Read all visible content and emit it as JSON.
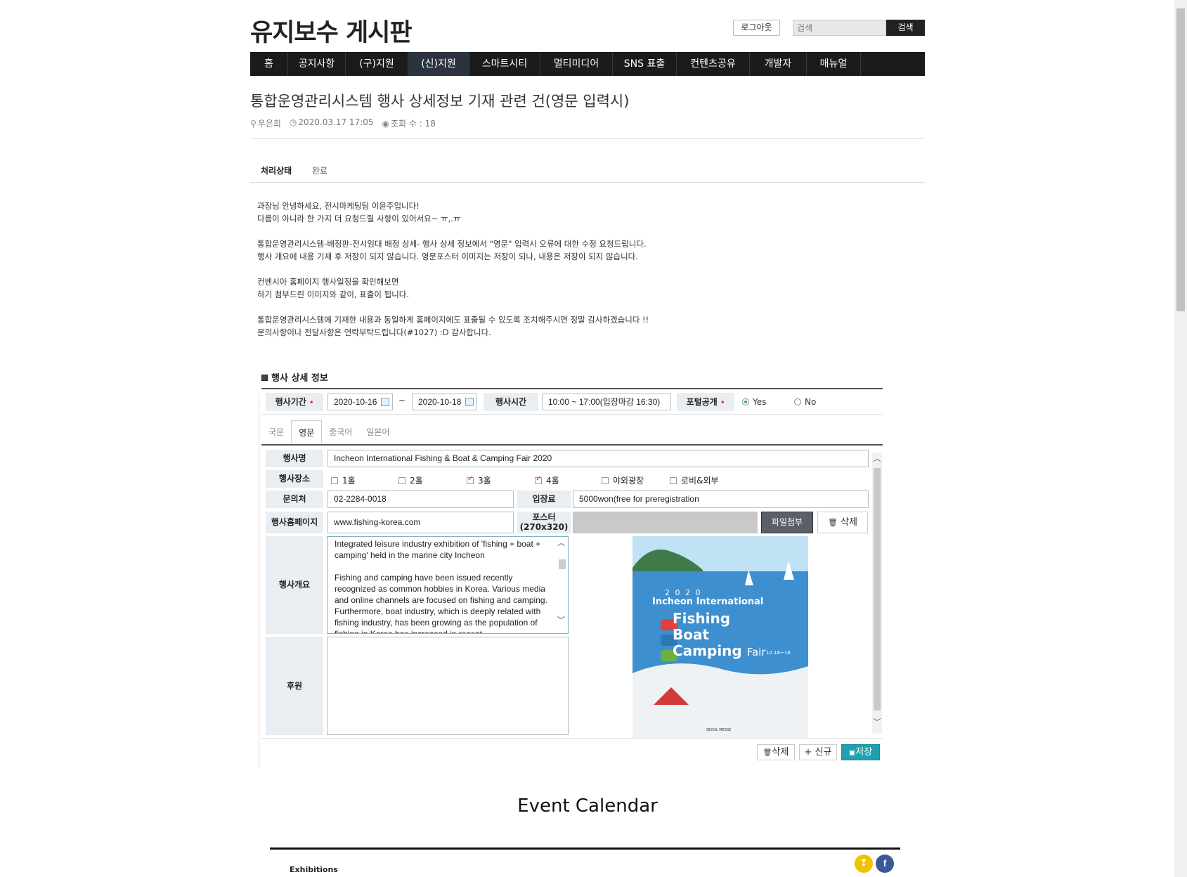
{
  "header": {
    "site_title": "유지보수 게시판",
    "logout_label": "로그아웃",
    "search_placeholder": "검색",
    "search_button": "검색"
  },
  "nav": [
    {
      "label": "홈"
    },
    {
      "label": "공지사항"
    },
    {
      "label": "(구)지원"
    },
    {
      "label": "(신)지원"
    },
    {
      "label": "스마트시티"
    },
    {
      "label": "멀티미디어"
    },
    {
      "label": "SNS 표출"
    },
    {
      "label": "컨텐츠공유"
    },
    {
      "label": "개발자"
    },
    {
      "label": "매뉴얼"
    }
  ],
  "post": {
    "title": "통합운영관리시스템 행사 상세정보 기재 관련 건(영문 입력시)",
    "author": "우은희",
    "datetime": "2020.03.17 17:05",
    "views": "조회 수 : 18",
    "status_label": "처리상태",
    "status_value": "완료",
    "body": "과장님 안녕하세요, 전시마케팅팀 이윤주입니다!\n다름이 아니라 한 가지 더 요청드릴 사항이 있어서요~ ㅠ,.ㅠ\n\n통합운영관리시스템-배정판-전시임대 배정 상세- 행사 상세 정보에서 \"영문\" 입력시 오류에 대한 수정 요청드립니다.\n행사 개요에 내용 기재 후 저장이 되지 않습니다. 영문포스터 이미지는 저장이 되나, 내용은 저장이 되지 않습니다.\n\n컨벤시아 홈페이지 행사일정을 확인해보면\n하기 첨부드린 이미지와 같이, 표출이 됩니다.\n\n통합운영관리시스템에 기재한 내용과 동일하게 홈페이지에도 표출될 수 있도록 조치해주시면 정말 감사하겠습니다 !!\n문의사항이나 전달사항은 연락부탁드립니다(#1027) :D 감사합니다."
  },
  "form": {
    "section_title": "행사 상세 정보",
    "period_label": "행사기간",
    "date_start": "2020-10-16",
    "date_sep": "~",
    "date_end": "2020-10-18",
    "time_label": "행사시간",
    "time_value": "10:00 ~ 17:00(입장마감 16:30)",
    "portal_label": "포털공개",
    "portal_yes": "Yes",
    "portal_no": "No",
    "tabs": [
      "국문",
      "영문",
      "중국어",
      "일본어"
    ],
    "name_label": "행사명",
    "name_value": "Incheon International Fishing & Boat & Camping Fair 2020",
    "venue_label": "행사장소",
    "venues": [
      {
        "label": "1홀",
        "checked": false
      },
      {
        "label": "2홀",
        "checked": false
      },
      {
        "label": "3홀",
        "checked": true
      },
      {
        "label": "4홀",
        "checked": true
      },
      {
        "label": "야외광장",
        "checked": false
      },
      {
        "label": "로비&외부",
        "checked": false
      }
    ],
    "contact_label": "문의처",
    "contact_value": "02-2284-0018",
    "fee_label": "입장료",
    "fee_value": "5000won(free for preregistration",
    "homepage_label": "행사홈페이지",
    "homepage_value": "www.fishing-korea.com",
    "poster_label_1": "포스터",
    "poster_label_2": "(270x320)",
    "attach_button": "파일첨부",
    "delete_button": "삭제",
    "overview_label": "행사개요",
    "overview_text": "Integrated leisure industry exhibition of 'fishing + boat + camping' held in the marine city Incheon\n\nFishing and camping have been issued recently recognized as common hobbies in Korea. Various media and online channels are focused on fishing and camping. Furthermore, boat industry, which is deeply related with fishing industry, has been growing as the population of fishing in Korea has increased in recent",
    "sponsor_label": "후원",
    "bottom_delete": "삭제",
    "bottom_new": "신규",
    "bottom_save": "저장"
  },
  "poster": {
    "year": "2 0 2 0",
    "line1": "Incheon International",
    "line2": "Fishing",
    "line3": "Boat",
    "line4": "Camping",
    "line4b": "Fair",
    "dates": "10.16~18",
    "sponsor_logos": "SEOUL MESSE"
  },
  "calendar": {
    "title": "Event Calendar",
    "category": "Exhibitions"
  },
  "colors": {
    "nav_bg": "#1b1b1b",
    "save_button": "#1fa0b0",
    "label_bg": "#e9eef3",
    "poster_bg": "#3d8fcf"
  }
}
